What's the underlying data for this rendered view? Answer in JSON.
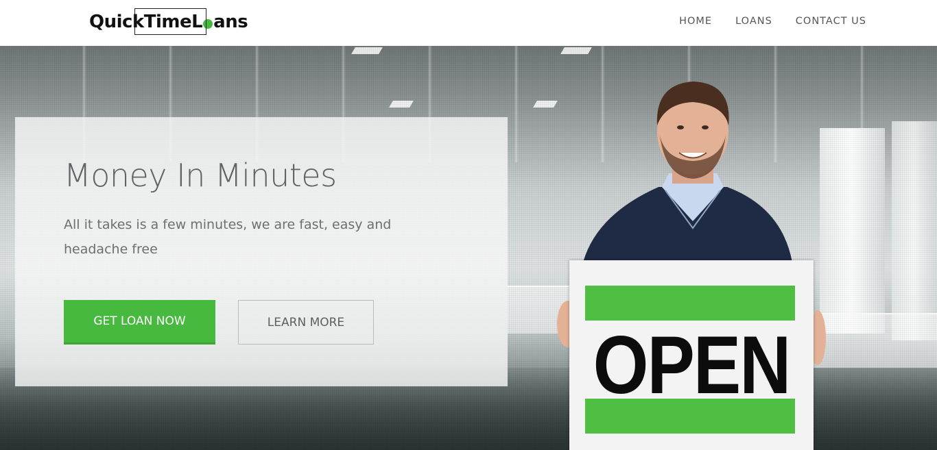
{
  "brand": {
    "logo_part1": "QuickTimeL",
    "logo_part2": "ans",
    "accent_color": "#47b93f"
  },
  "nav": {
    "items": [
      {
        "label": "HOME"
      },
      {
        "label": "LOANS"
      },
      {
        "label": "CONTACT US"
      }
    ]
  },
  "hero": {
    "title": "Money In Minutes",
    "subtitle": "All it takes is a few minutes, we are fast, easy and headache free",
    "primary_button": "GET LOAN NOW",
    "secondary_button": "LEARN MORE",
    "sign_text": "OPEN"
  },
  "icons": {
    "logo_dot": "green-dot-icon"
  }
}
